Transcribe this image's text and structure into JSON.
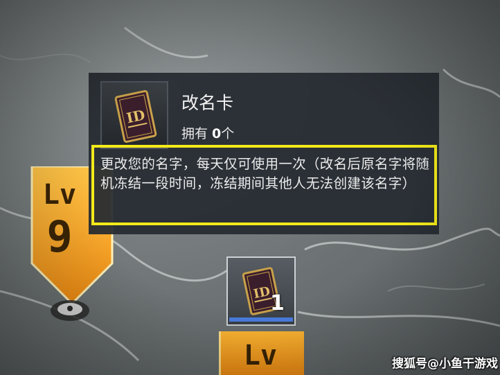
{
  "tooltip": {
    "item_name": "改名卡",
    "owned_prefix": "拥有 ",
    "owned_count": "0",
    "owned_suffix": "个",
    "description": "更改您的名字，每天仅可使用一次（改名后原名字将随机冻结一段时间，冻结期间其他人无法创建该名字）"
  },
  "map": {
    "level_banner_label": "Lv",
    "level_banner_value": "9",
    "level_banner2_label": "Lv",
    "item_slot_count": "1"
  },
  "icons": {
    "rename_card": "rename-card-icon",
    "map_pin": "map-pin-icon"
  },
  "colors": {
    "highlight_border": "#f3ea1a",
    "banner_orange": "#f5a623",
    "slot_bar": "#4a7de0"
  },
  "watermark": "搜狐号@小鱼干游戏"
}
